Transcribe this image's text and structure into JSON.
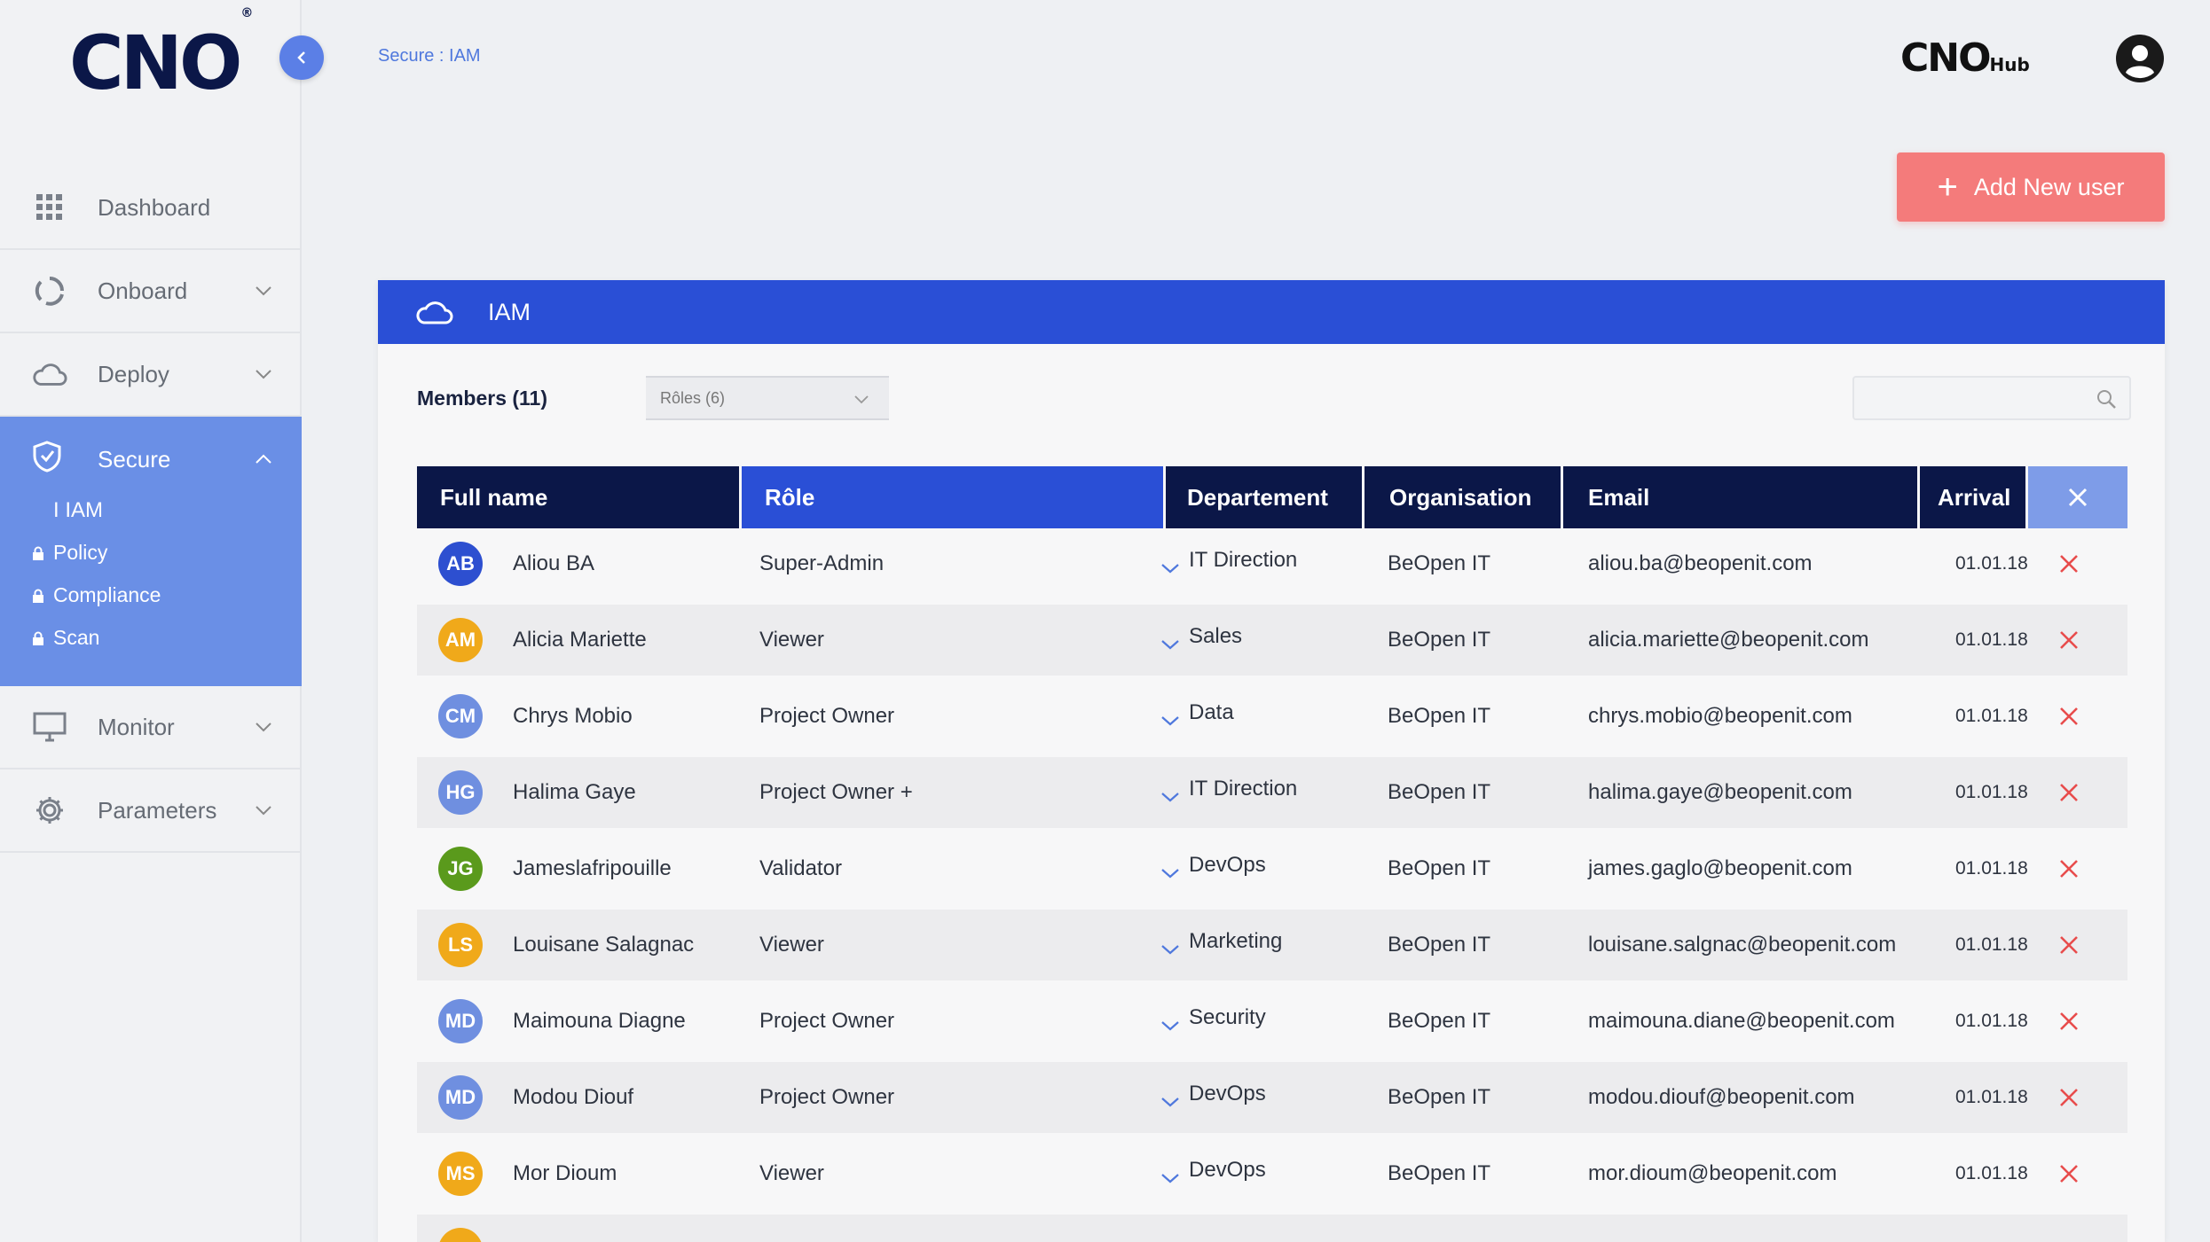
{
  "app": {
    "logo": "CNO",
    "logo_mark": "®",
    "hub_logo": "CNO",
    "hub_logo_suffix": "Hub",
    "breadcrumb": "Secure : IAM"
  },
  "sidebar": {
    "items": [
      {
        "label": "Dashboard",
        "icon": "grid-icon"
      },
      {
        "label": "Onboard",
        "icon": "onboard-icon"
      },
      {
        "label": "Deploy",
        "icon": "cloud-icon"
      },
      {
        "label": "Secure",
        "icon": "shield-icon"
      },
      {
        "label": "Monitor",
        "icon": "monitor-icon"
      },
      {
        "label": "Parameters",
        "icon": "gear-icon"
      }
    ],
    "secure_sub": [
      {
        "label": "I IAM"
      },
      {
        "label": "Policy"
      },
      {
        "label": "Compliance"
      },
      {
        "label": "Scan"
      }
    ]
  },
  "toolbar": {
    "add_user_label": "Add New user"
  },
  "panel": {
    "title": "IAM",
    "members_label": "Members (11)",
    "roles_select": "Rôles (6)",
    "search_placeholder": ""
  },
  "table": {
    "columns": [
      "Full name",
      "Rôle",
      "Departement",
      "Organisation",
      "Email",
      "Arrival"
    ],
    "rows": [
      {
        "initials": "AB",
        "name": "Aliou BA",
        "role": "Super-Admin",
        "dept": "IT Direction",
        "org": "BeOpen IT",
        "email": "aliou.ba@beopenit.com",
        "arrival": "01.01.18",
        "color": "#2d4fd0"
      },
      {
        "initials": "AM",
        "name": "Alicia Mariette",
        "role": "Viewer",
        "dept": "Sales",
        "org": "BeOpen IT",
        "email": "alicia.mariette@beopenit.com",
        "arrival": "01.01.18",
        "color": "#f0a91a"
      },
      {
        "initials": "CM",
        "name": "Chrys Mobio",
        "role": "Project Owner",
        "dept": "Data",
        "org": "BeOpen IT",
        "email": "chrys.mobio@beopenit.com",
        "arrival": "01.01.18",
        "color": "#6f8fe0"
      },
      {
        "initials": "HG",
        "name": "Halima Gaye",
        "role": "Project Owner +",
        "dept": "IT Direction",
        "org": "BeOpen IT",
        "email": "halima.gaye@beopenit.com",
        "arrival": "01.01.18",
        "color": "#6f8fe0"
      },
      {
        "initials": "JG",
        "name": "Jameslafripouille",
        "role": "Validator",
        "dept": "DevOps",
        "org": "BeOpen IT",
        "email": "james.gaglo@beopenit.com",
        "arrival": "01.01.18",
        "color": "#5a9a1c"
      },
      {
        "initials": "LS",
        "name": "Louisane Salagnac",
        "role": "Viewer",
        "dept": "Marketing",
        "org": "BeOpen IT",
        "email": "louisane.salgnac@beopenit.com",
        "arrival": "01.01.18",
        "color": "#f0a91a"
      },
      {
        "initials": "MD",
        "name": "Maimouna Diagne",
        "role": "Project Owner",
        "dept": "Security",
        "org": "BeOpen IT",
        "email": "maimouna.diane@beopenit.com",
        "arrival": "01.01.18",
        "color": "#6f8fe0"
      },
      {
        "initials": "MD",
        "name": "Modou Diouf",
        "role": "Project Owner",
        "dept": "DevOps",
        "org": "BeOpen IT",
        "email": "modou.diouf@beopenit.com",
        "arrival": "01.01.18",
        "color": "#6f8fe0"
      },
      {
        "initials": "MS",
        "name": "Mor Dioum",
        "role": "Viewer",
        "dept": "DevOps",
        "org": "BeOpen IT",
        "email": "mor.dioum@beopenit.com",
        "arrival": "01.01.18",
        "color": "#f0a91a"
      }
    ]
  },
  "colors": {
    "navy": "#0b1748",
    "blue": "#2a4fd6",
    "sidebar_active": "#6a8fe6",
    "accent_red": "#f47b7b",
    "delete_red": "#e84c4c"
  }
}
